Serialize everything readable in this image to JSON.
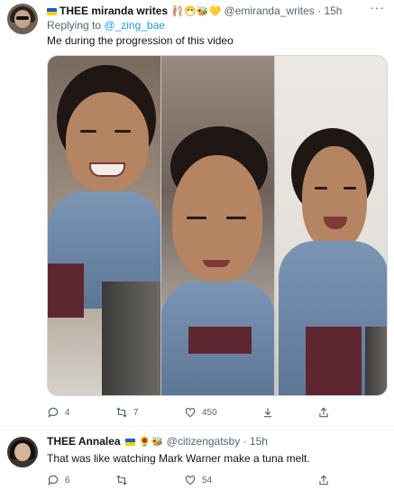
{
  "tweet1": {
    "author_name": "THEE miranda writes",
    "author_emojis": "🩰😷🐝💛",
    "handle": "@emiranda_writes",
    "separator": "·",
    "time": "15h",
    "more": "···",
    "reply_prefix": "Replying to",
    "reply_to": "@_zing_bae",
    "text": "Me during the progression of this video",
    "reply_count": "4",
    "retweet_count": "7",
    "like_count": "450"
  },
  "tweet2": {
    "author_name": "THEE Annalea",
    "author_emojis": "🌻🐝",
    "handle": "@citizengatsby",
    "separator": "·",
    "time": "15h",
    "text": "That was like watching Mark Warner make a tuna melt.",
    "reply_count": "6",
    "retweet_count": "",
    "like_count": "54"
  },
  "colors": {
    "link": "#1d9bf0",
    "secondary_text": "#536471",
    "primary_text": "#0f1419",
    "border": "#eff3f4"
  },
  "icons": [
    "reply-icon",
    "retweet-icon",
    "like-icon",
    "download-icon",
    "share-icon",
    "ukraine-flag-icon"
  ]
}
